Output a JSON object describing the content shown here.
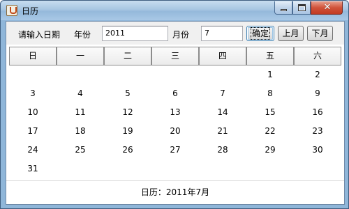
{
  "window": {
    "title": "日历"
  },
  "input_bar": {
    "prompt": "请输入日期",
    "year_label": "年份",
    "year_value": "2011",
    "month_label": "月份",
    "month_value": "7",
    "confirm_label": "确定",
    "prev_label": "上月",
    "next_label": "下月"
  },
  "calendar": {
    "headers": [
      "日",
      "一",
      "二",
      "三",
      "四",
      "五",
      "六"
    ],
    "weeks": [
      [
        "",
        "",
        "",
        "",
        "",
        "1",
        "2"
      ],
      [
        "3",
        "4",
        "5",
        "6",
        "7",
        "8",
        "9"
      ],
      [
        "10",
        "11",
        "12",
        "13",
        "14",
        "15",
        "16"
      ],
      [
        "17",
        "18",
        "19",
        "20",
        "21",
        "22",
        "23"
      ],
      [
        "24",
        "25",
        "26",
        "27",
        "28",
        "29",
        "30"
      ],
      [
        "31",
        "",
        "",
        "",
        "",
        "",
        ""
      ]
    ]
  },
  "footer": {
    "text": "日历：2011年7月"
  }
}
